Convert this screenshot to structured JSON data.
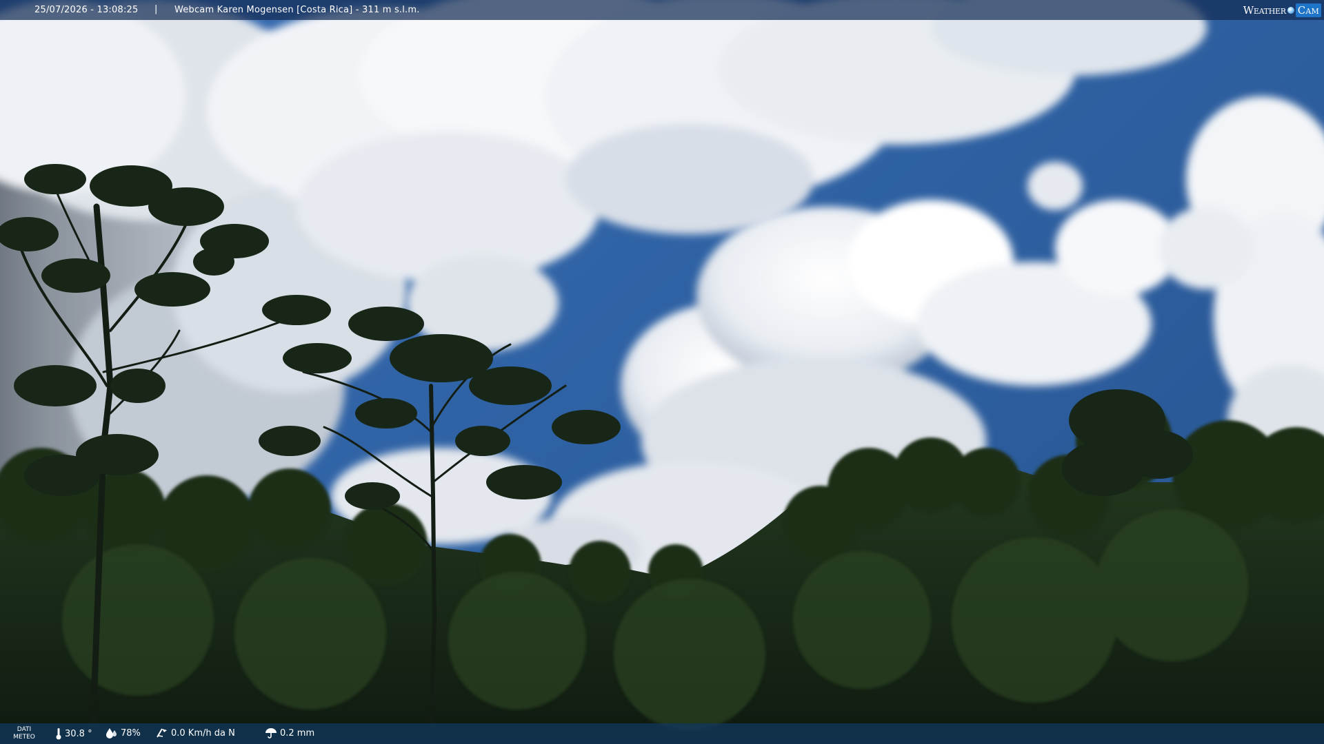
{
  "header": {
    "datetime": "25/07/2026 - 13:08:25",
    "separator": "|",
    "title": "Webcam Karen Mogensen [Costa Rica]  - 311 m s.l.m."
  },
  "logo": {
    "word_a": "Weather",
    "word_b": "Cam"
  },
  "footer": {
    "dati_label_1": "DATI",
    "dati_label_2": "METEO",
    "temperature": "30.8 °",
    "humidity": "78%",
    "wind": "0.0 Km/h da N",
    "rain": "0.2 mm",
    "icons": [
      "thermometer-icon",
      "humidity-icon",
      "wind-icon",
      "rain-icon"
    ]
  },
  "colors": {
    "sky": "#2f62a4",
    "cloud": "#f3f5f8",
    "forest_dark": "#142214",
    "forest_mid": "#1f351c",
    "bar_bg": "#14385c"
  }
}
